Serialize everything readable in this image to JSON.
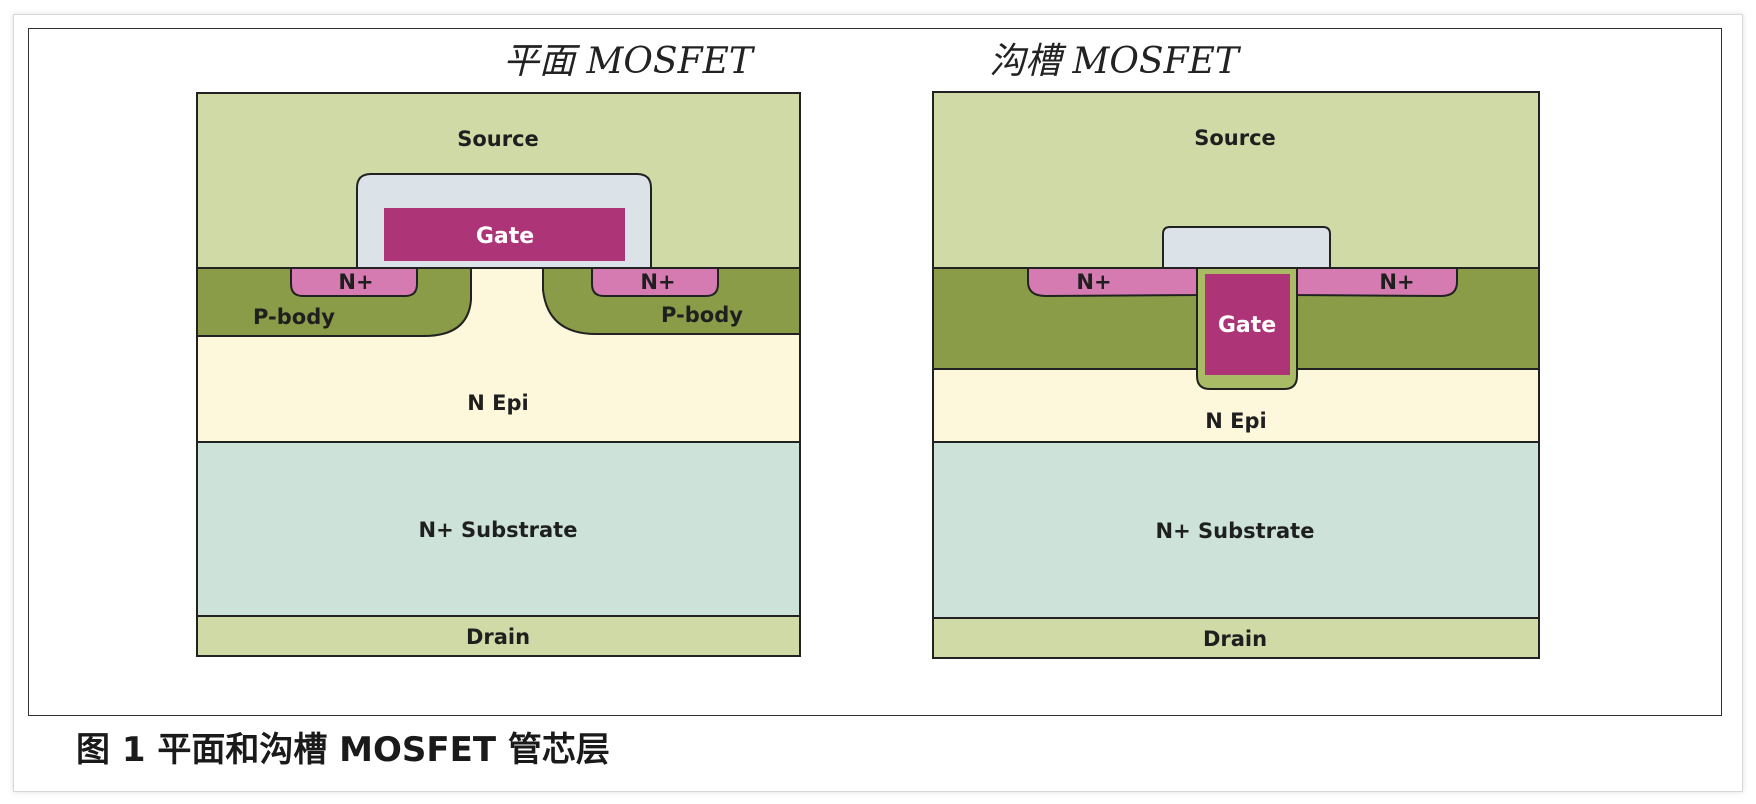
{
  "planar": {
    "title": "平面 MOSFET",
    "source": "Source",
    "gate": "Gate",
    "n_plus_left": "N+",
    "n_plus_right": "N+",
    "p_body_left": "P-body",
    "p_body_right": "P-body",
    "n_epi": "N Epi",
    "substrate": "N+ Substrate",
    "drain": "Drain"
  },
  "trench": {
    "title": "沟槽 MOSFET",
    "source": "Source",
    "gate": "Gate",
    "n_plus_left": "N+",
    "n_plus_right": "N+",
    "n_epi": "N Epi",
    "substrate": "N+ Substrate",
    "drain": "Drain"
  },
  "caption": "图 1 平面和沟槽 MOSFET 管芯层",
  "colors": {
    "source": "#d0daa6",
    "oxide": "#dce3e8",
    "gate": "#ad3577",
    "n_plus": "#d67bb1",
    "p_body": "#8a9c47",
    "n_epi": "#fdf8dc",
    "substrate": "#cde3da",
    "drain": "#d0daa6",
    "outline": "#222222"
  }
}
